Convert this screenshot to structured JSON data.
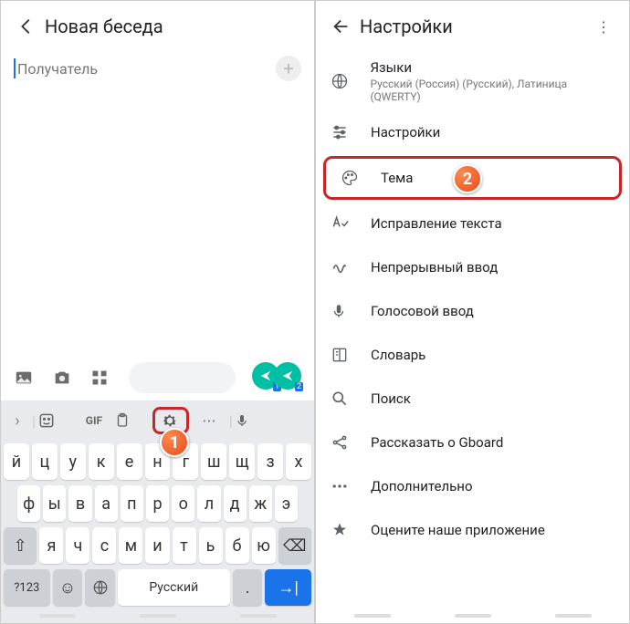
{
  "left": {
    "title": "Новая беседа",
    "recipient_placeholder": "Получатель",
    "keyboard": {
      "suggestion_gif": "GIF",
      "row1": [
        "й",
        "ц",
        "у",
        "к",
        "е",
        "н",
        "г",
        "ш",
        "щ",
        "з",
        "х"
      ],
      "row2": [
        "ф",
        "ы",
        "в",
        "а",
        "п",
        "р",
        "о",
        "л",
        "д",
        "ж",
        "э"
      ],
      "row3_shift": "⇧",
      "row3": [
        "я",
        "ч",
        "с",
        "м",
        "и",
        "т",
        "ь",
        "б",
        "ю"
      ],
      "row3_back": "⌫",
      "sym": "?123",
      "space": "Русский",
      "period": ".",
      "enter": "→|"
    },
    "sim1": "1",
    "sim2": "2",
    "badge": "1"
  },
  "right": {
    "title": "Настройки",
    "badge": "2",
    "items": [
      {
        "icon": "globe",
        "label": "Языки",
        "sub": "Русский (Россия) (Русский), Латиница (QWERTY)"
      },
      {
        "icon": "sliders",
        "label": "Настройки"
      },
      {
        "icon": "palette",
        "label": "Тема",
        "highlight": true
      },
      {
        "icon": "spell",
        "label": "Исправление текста"
      },
      {
        "icon": "gesture",
        "label": "Непрерывный ввод"
      },
      {
        "icon": "mic",
        "label": "Голосовой ввод"
      },
      {
        "icon": "book",
        "label": "Словарь"
      },
      {
        "icon": "search",
        "label": "Поиск"
      },
      {
        "icon": "share",
        "label": "Рассказать о Gboard"
      },
      {
        "icon": "dots",
        "label": "Дополнительно"
      },
      {
        "icon": "star",
        "label": "Оцените наше приложение"
      }
    ]
  }
}
